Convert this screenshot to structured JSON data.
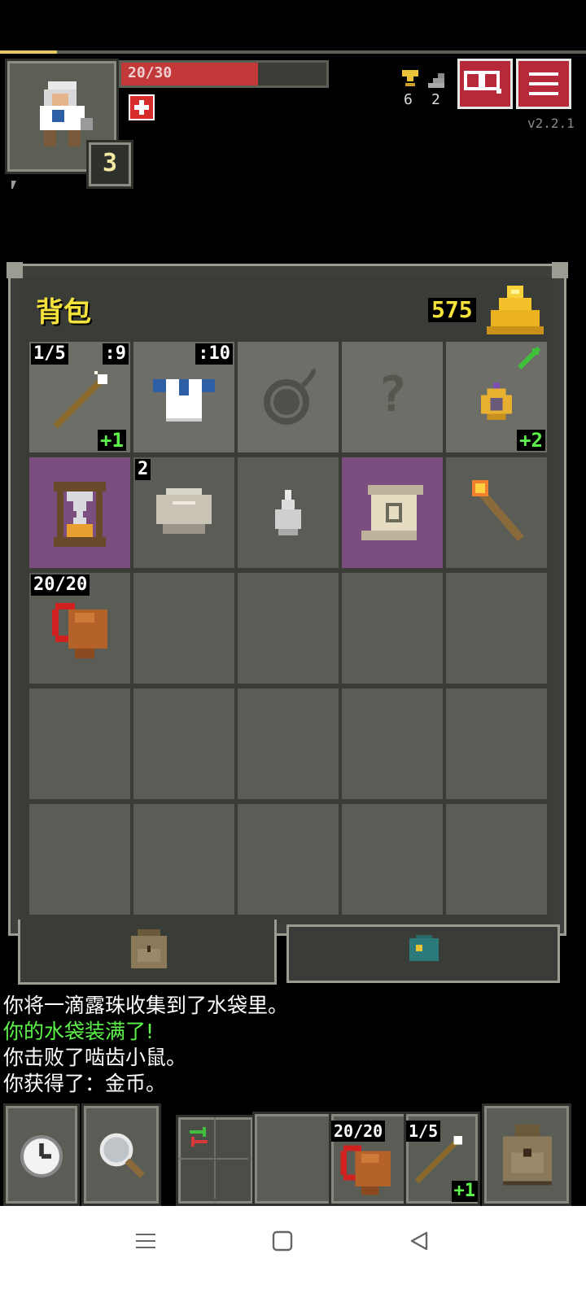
{
  "hud": {
    "hp_text": "20/30",
    "hp_fraction": 0.667,
    "depth_level": "3",
    "trophy_count": "6",
    "stairs_count": "2",
    "version": "v2.2.1"
  },
  "backpack": {
    "title": "背包",
    "gold": "575",
    "row1": {
      "wand_charges": "1/5",
      "wand_tier": ":9",
      "wand_bonus": "+1",
      "armor_tier": ":10",
      "ring_bonus": "+2"
    },
    "row2": {
      "stone_count": "2"
    },
    "row3": {
      "waterskin_text": "20/20"
    }
  },
  "log": {
    "line1": "你将一滴露珠收集到了水袋里。",
    "line2": "你的水袋装满了!",
    "line3": "你击败了啮齿小鼠。",
    "line4": "你获得了：金币。"
  },
  "toolbar": {
    "quick_waterskin": "20/20",
    "quick_wand_charges": "1/5",
    "quick_wand_bonus": "+1"
  },
  "colors": {
    "panel": "#5c5f56",
    "slot": "#5a5d55",
    "purple_slot": "#7a4f80",
    "hp_bar": "#c3393a",
    "gold_text": "#f5e23a",
    "green_text": "#5df54a",
    "danger_button": "#b8283b"
  }
}
